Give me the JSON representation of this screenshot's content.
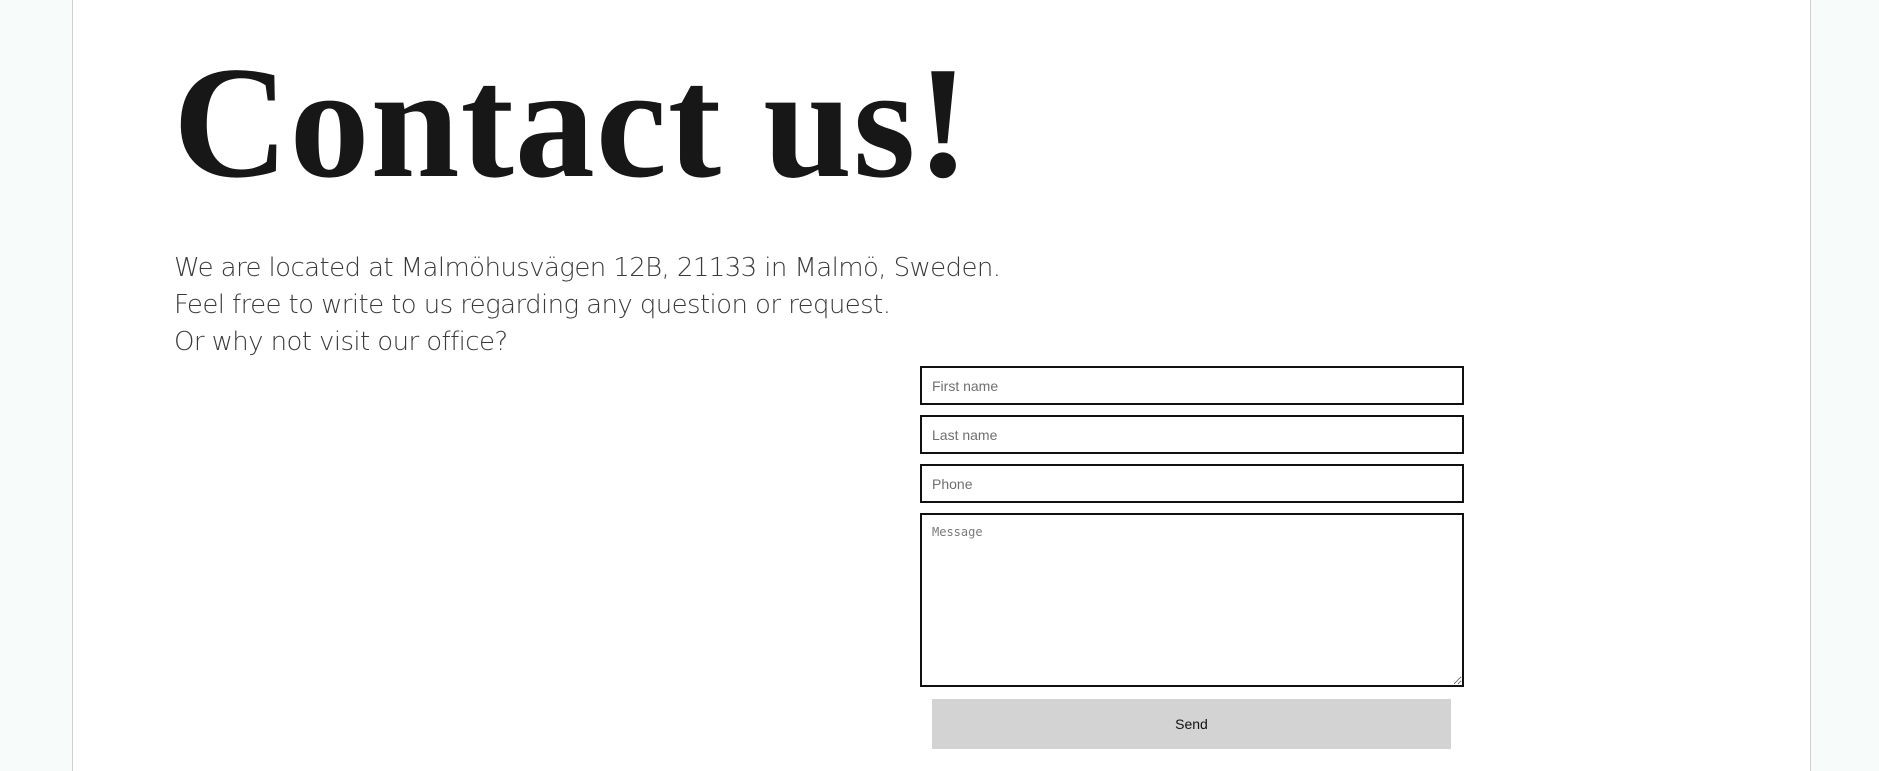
{
  "contact": {
    "title": "Contact us!",
    "intro_lines": [
      "We are located at Malmöhusvägen 12B, 21133 in Malmö, Sweden.",
      "Feel free to write to us regarding any question or request.",
      "Or why not visit our office?"
    ]
  },
  "form": {
    "first_name_placeholder": "First name",
    "last_name_placeholder": "Last name",
    "phone_placeholder": "Phone",
    "message_placeholder": "Message",
    "send_label": "Send"
  }
}
